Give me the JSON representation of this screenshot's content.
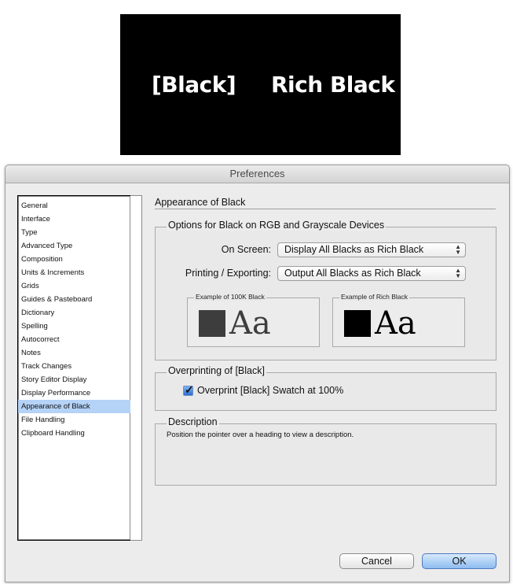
{
  "banner": {
    "left_label": "[Black]",
    "right_label": "Rich Black",
    "background": "#000000",
    "text_color": "#ffffff"
  },
  "dialog": {
    "title": "Preferences"
  },
  "sidebar": {
    "items": [
      {
        "label": "General"
      },
      {
        "label": "Interface"
      },
      {
        "label": "Type"
      },
      {
        "label": "Advanced Type"
      },
      {
        "label": "Composition"
      },
      {
        "label": "Units & Increments"
      },
      {
        "label": "Grids"
      },
      {
        "label": "Guides & Pasteboard"
      },
      {
        "label": "Dictionary"
      },
      {
        "label": "Spelling"
      },
      {
        "label": "Autocorrect"
      },
      {
        "label": "Notes"
      },
      {
        "label": "Track Changes"
      },
      {
        "label": "Story Editor Display"
      },
      {
        "label": "Display Performance"
      },
      {
        "label": "Appearance of Black"
      },
      {
        "label": "File Handling"
      },
      {
        "label": "Clipboard Handling"
      }
    ],
    "selected": "Appearance of Black",
    "selected_color": "#b5d2f7"
  },
  "main": {
    "title": "Appearance of Black",
    "options_group": {
      "title": "Options for Black on RGB and Grayscale Devices",
      "on_screen": {
        "label": "On Screen:",
        "value": "Display All Blacks as Rich Black"
      },
      "printing": {
        "label": "Printing / Exporting:",
        "value": "Output All Blacks as Rich Black"
      },
      "example_100k": {
        "title": "Example of 100K Black",
        "text": "Aa",
        "color": "#3d3d3d"
      },
      "example_rich": {
        "title": "Example of Rich Black",
        "text": "Aa",
        "color": "#000000"
      }
    },
    "overprint_group": {
      "title": "Overprinting of [Black]",
      "checkbox_label": "Overprint [Black] Swatch at 100%",
      "checked": true
    },
    "description_group": {
      "title": "Description",
      "text": "Position the pointer over a heading to view a description."
    }
  },
  "buttons": {
    "cancel": "Cancel",
    "ok": "OK"
  }
}
